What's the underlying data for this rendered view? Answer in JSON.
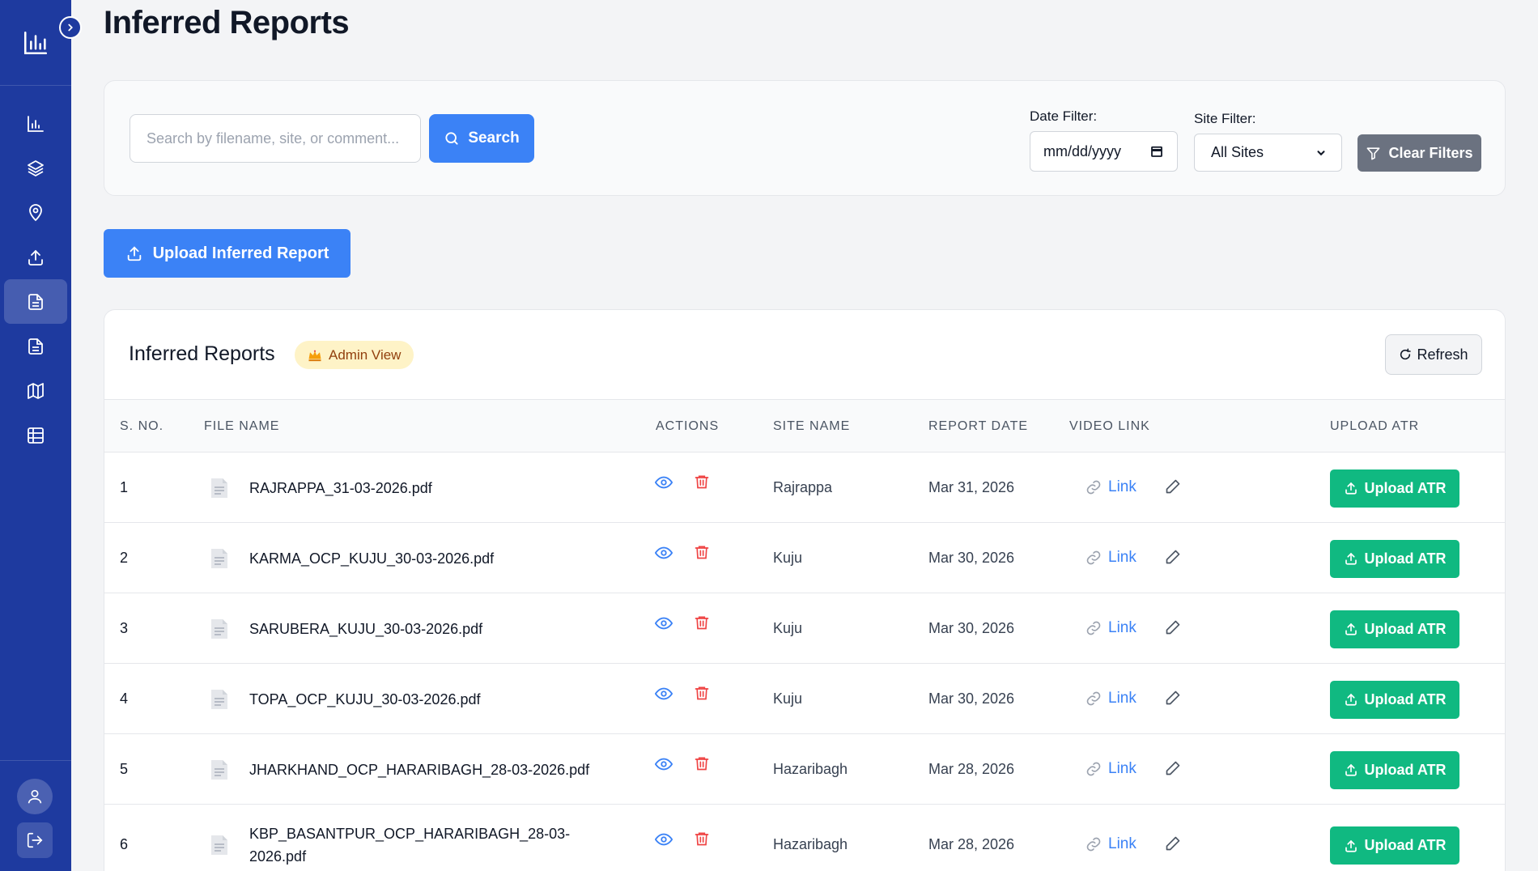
{
  "page": {
    "title": "Inferred Reports"
  },
  "sidebar": {
    "logo_icon": "bar-chart-icon",
    "items": [
      {
        "icon": "bar-chart-icon",
        "active": false
      },
      {
        "icon": "layers-icon",
        "active": false
      },
      {
        "icon": "map-pin-icon",
        "active": false
      },
      {
        "icon": "upload-icon",
        "active": false
      },
      {
        "icon": "document-icon",
        "active": true
      },
      {
        "icon": "document-icon",
        "active": false
      },
      {
        "icon": "map-icon",
        "active": false
      },
      {
        "icon": "table-icon",
        "active": false
      }
    ],
    "bottom": [
      {
        "icon": "user-icon"
      },
      {
        "icon": "logout-icon"
      }
    ]
  },
  "filters": {
    "search_placeholder": "Search by filename, site, or comment...",
    "search_label": "Search",
    "date_label": "Date Filter:",
    "date_value": "mm/dd/yyyy",
    "site_label": "Site Filter:",
    "site_value": "All Sites",
    "clear_label": "Clear Filters"
  },
  "upload": {
    "label": "Upload Inferred Report"
  },
  "table": {
    "title": "Inferred Reports",
    "badge": "Admin View",
    "refresh_label": "Refresh",
    "columns": [
      "S. NO.",
      "FILE NAME",
      "ACTIONS",
      "SITE NAME",
      "REPORT DATE",
      "VIDEO LINK",
      "UPLOAD ATR"
    ],
    "link_label": "Link",
    "atr_label": "Upload ATR",
    "rows": [
      {
        "sno": "1",
        "file": "RAJRAPPA_31-03-2026.pdf",
        "site": "Rajrappa",
        "date": "Mar 31, 2026"
      },
      {
        "sno": "2",
        "file": "KARMA_OCP_KUJU_30-03-2026.pdf",
        "site": "Kuju",
        "date": "Mar 30, 2026"
      },
      {
        "sno": "3",
        "file": "SARUBERA_KUJU_30-03-2026.pdf",
        "site": "Kuju",
        "date": "Mar 30, 2026"
      },
      {
        "sno": "4",
        "file": "TOPA_OCP_KUJU_30-03-2026.pdf",
        "site": "Kuju",
        "date": "Mar 30, 2026"
      },
      {
        "sno": "5",
        "file": "JHARKHAND_OCP_HARARIBAGH_28-03-2026.pdf",
        "site": "Hazaribagh",
        "date": "Mar 28, 2026"
      },
      {
        "sno": "6",
        "file_line1": "KBP_BASANTPUR_OCP_HARARIBAGH_28-03-",
        "file_line2": "2026.pdf",
        "site": "Hazaribagh",
        "date": "Mar 28, 2026"
      }
    ]
  },
  "colors": {
    "sidebar": "#1e3a9f",
    "primary": "#3b82f6",
    "success": "#10b981",
    "danger": "#ef4444",
    "muted_button": "#6b7280"
  }
}
